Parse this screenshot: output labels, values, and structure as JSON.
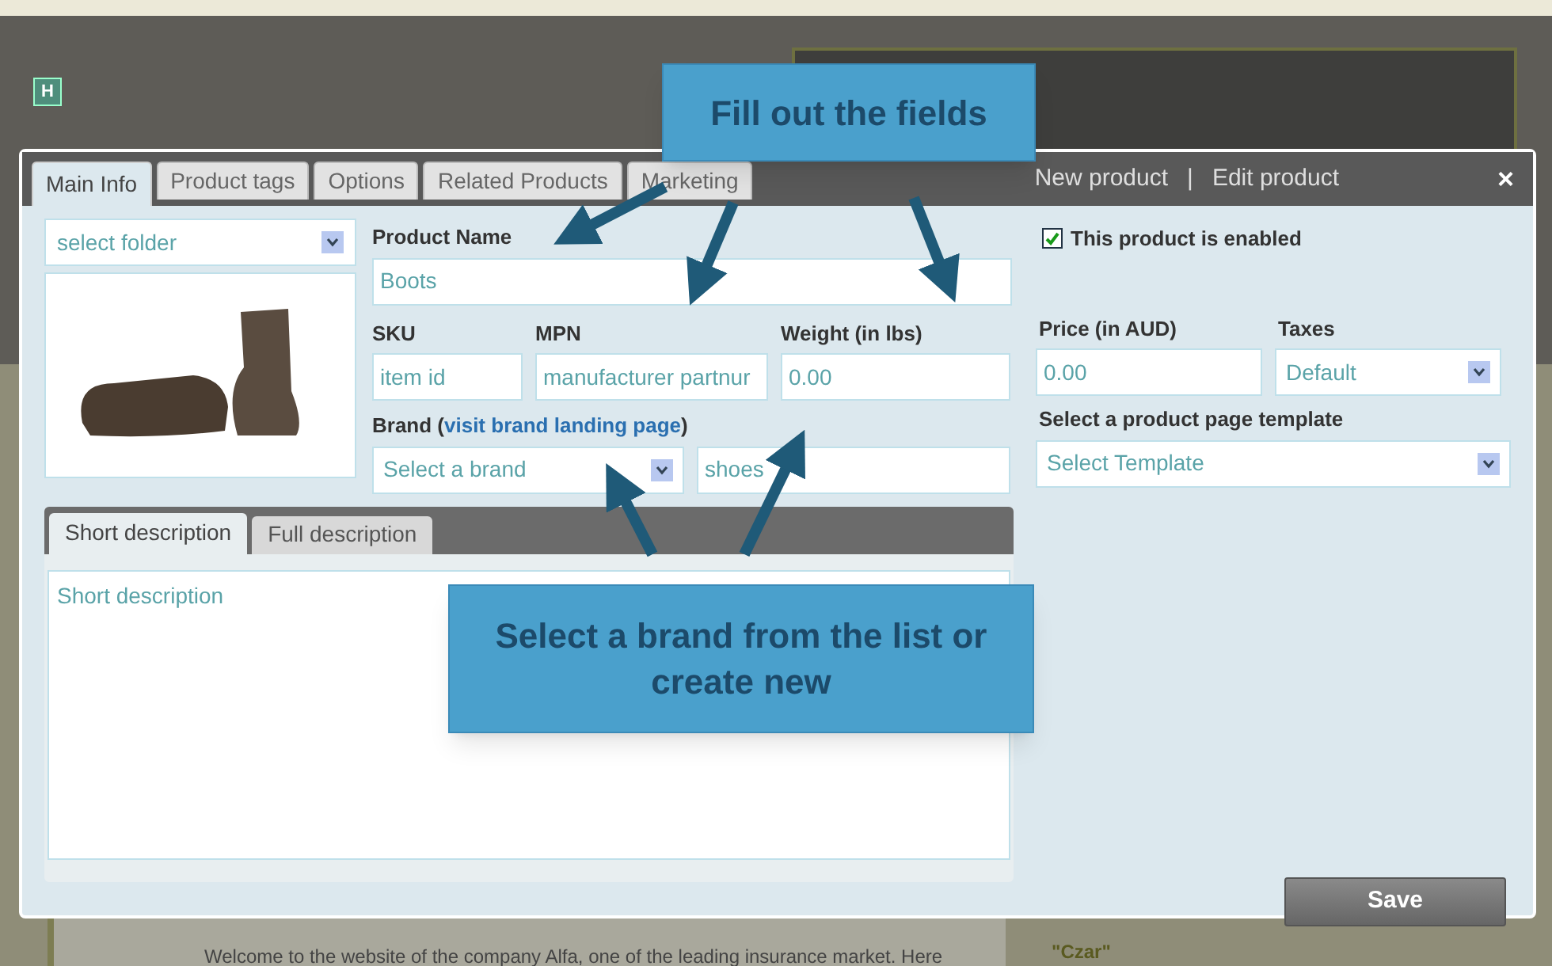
{
  "background": {
    "badge": "H",
    "welcome_text": "Welcome to the website of the company Alfa, one of the leading insurance market. Here",
    "quote": "\"Czar\""
  },
  "dialog": {
    "tabs": [
      {
        "label": "Main Info",
        "selected": true
      },
      {
        "label": "Product tags",
        "selected": false
      },
      {
        "label": "Options",
        "selected": false
      },
      {
        "label": "Related Products",
        "selected": false
      },
      {
        "label": "Marketing",
        "selected": false
      }
    ],
    "header_links": [
      "New product",
      "Edit product"
    ],
    "separator": "|",
    "close": "×",
    "folder_select": {
      "value": "select folder"
    },
    "product_name": {
      "label": "Product Name",
      "value": "Boots"
    },
    "sku": {
      "label": "SKU",
      "placeholder": "item id"
    },
    "mpn": {
      "label": "MPN",
      "placeholder": "manufacturer partnur"
    },
    "weight": {
      "label": "Weight (in lbs)",
      "value": "0.00"
    },
    "brand": {
      "label": "Brand (",
      "link": "visit brand landing page",
      "label_end": ")",
      "select": "Select a brand",
      "value": "shoes"
    },
    "enabled": {
      "label": "This product is enabled",
      "checked": true
    },
    "price": {
      "label": "Price (in AUD)",
      "value": "0.00"
    },
    "taxes": {
      "label": "Taxes",
      "value": "Default"
    },
    "template": {
      "label": "Select a product page template",
      "value": "Select Template"
    },
    "description_tabs": [
      {
        "label": "Short description",
        "selected": true
      },
      {
        "label": "Full description",
        "selected": false
      }
    ],
    "description": {
      "placeholder": "Short description"
    },
    "save": "Save"
  },
  "callouts": [
    "Fill out the fields",
    "Select a brand from the list or create new"
  ]
}
